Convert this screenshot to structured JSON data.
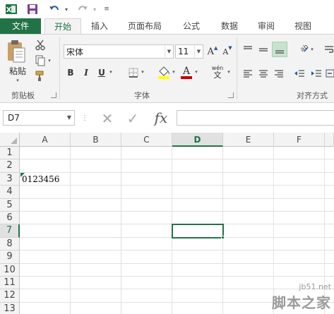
{
  "qat": {
    "icons": [
      "excel-logo-icon",
      "save-icon",
      "undo-icon",
      "redo-icon",
      "customize-qat-icon"
    ]
  },
  "tabs": [
    "文件",
    "开始",
    "插入",
    "页面布局",
    "公式",
    "数据",
    "审阅",
    "视图"
  ],
  "ribbon": {
    "clipboard": {
      "paste_label": "粘贴",
      "group_label": "剪贴板"
    },
    "font": {
      "font_name": "宋体",
      "font_size": "11",
      "group_label": "字体",
      "bold": "B",
      "italic": "I",
      "underline": "U",
      "phonetic": "wén"
    },
    "alignment": {
      "group_label": "对齐方式"
    }
  },
  "formula_bar": {
    "name_box": "D7",
    "fx_label": "fx",
    "content": ""
  },
  "sheet": {
    "columns": [
      "A",
      "B",
      "C",
      "D",
      "E",
      "F"
    ],
    "rows": [
      "1",
      "2",
      "3",
      "4",
      "5",
      "6",
      "7",
      "8",
      "9",
      "10",
      "11",
      "12",
      "13"
    ],
    "active_cell": "D7",
    "cells": {
      "A3": "0123456"
    }
  },
  "watermark": {
    "url": "jb51.net",
    "text": "脚本之家"
  },
  "colors": {
    "accent": "#217346",
    "ribbon_bg": "#f3f3f3"
  }
}
